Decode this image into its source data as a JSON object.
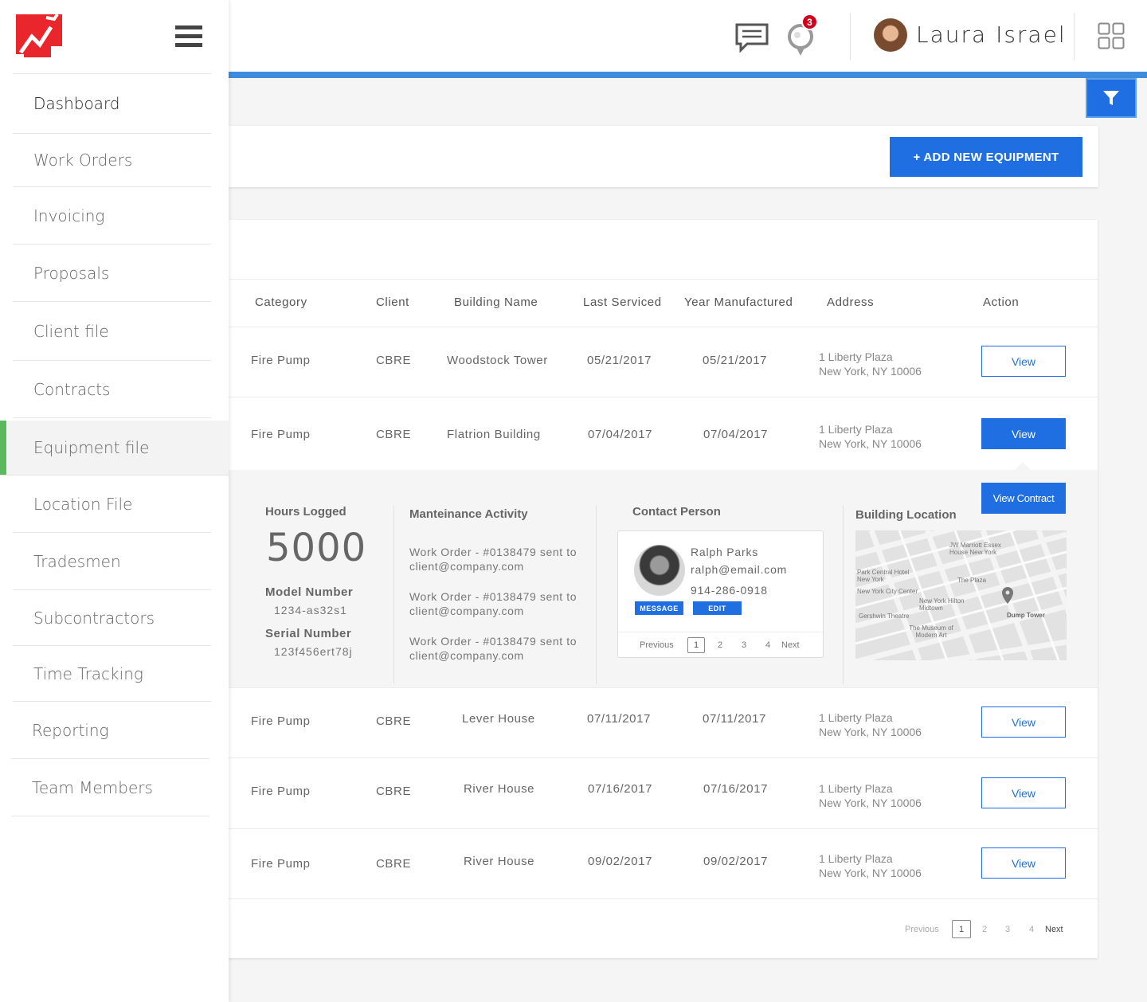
{
  "header": {
    "user_name": "Laura Israel",
    "notification_count": "3",
    "icons": [
      "chat-icon",
      "bell-icon",
      "apps-grid-icon",
      "filter-icon",
      "hamburger-menu-icon"
    ]
  },
  "sidebar": {
    "items": [
      {
        "label": "Dashboard"
      },
      {
        "label": "Work Orders"
      },
      {
        "label": "Invoicing"
      },
      {
        "label": "Proposals"
      },
      {
        "label": "Client file"
      },
      {
        "label": "Contracts"
      },
      {
        "label": "Equipment file"
      },
      {
        "label": "Location File"
      },
      {
        "label": "Tradesmen"
      },
      {
        "label": "Subcontractors"
      },
      {
        "label": "Time Tracking"
      },
      {
        "label": "Reporting"
      },
      {
        "label": "Team Members"
      }
    ],
    "active": "Equipment file",
    "active_color": "#5cb85c"
  },
  "toolbar": {
    "add_label": "+ ADD NEW EQUIPMENT"
  },
  "table": {
    "headers": [
      "Category",
      "Client",
      "Building Name",
      "Last Serviced",
      "Year Manufactured",
      "Address",
      "Action"
    ],
    "rows": [
      {
        "category": "Fire Pump",
        "client": "CBRE",
        "building": "Woodstock Tower",
        "last_serviced": "05/21/2017",
        "year": "05/21/2017",
        "addr1": "1 Liberty Plaza",
        "addr2": "New York, NY 10006",
        "action": "View"
      },
      {
        "category": "Fire Pump",
        "client": "CBRE",
        "building": "Flatrion Building",
        "last_serviced": "07/04/2017",
        "year": "07/04/2017",
        "addr1": "1 Liberty Plaza",
        "addr2": "New York, NY 10006",
        "action": "View"
      },
      {
        "category": "Fire Pump",
        "client": "CBRE",
        "building": "Lever House",
        "last_serviced": "07/11/2017",
        "year": "07/11/2017",
        "addr1": "1 Liberty Plaza",
        "addr2": "New York, NY 10006",
        "action": "View"
      },
      {
        "category": "Fire Pump",
        "client": "CBRE",
        "building": "River House",
        "last_serviced": "07/16/2017",
        "year": "07/16/2017",
        "addr1": "1 Liberty Plaza",
        "addr2": "New York, NY 10006",
        "action": "View"
      },
      {
        "category": "Fire Pump",
        "client": "CBRE",
        "building": "River House",
        "last_serviced": "09/02/2017",
        "year": "09/02/2017",
        "addr1": "1 Liberty Plaza",
        "addr2": "New York, NY 10006",
        "action": "View"
      }
    ],
    "pagination": {
      "prev": "Previous",
      "pages": [
        "1",
        "2",
        "3",
        "4"
      ],
      "next": "Next"
    }
  },
  "detail": {
    "hours_title": "Hours Logged",
    "hours_value": "5000",
    "model_label": "Model Number",
    "model_value": "1234-as32s1",
    "serial_label": "Serial Number",
    "serial_value": "123f456ert78j",
    "activity_title": "Manteinance Activity",
    "activities": [
      {
        "line1": "Work Order - #0138479 sent to",
        "line2": "client@company.com"
      },
      {
        "line1": "Work Order - #0138479 sent to",
        "line2": "client@company.com"
      },
      {
        "line1": "Work Order - #0138479 sent to",
        "line2": "client@company.com"
      }
    ],
    "contact_title": "Contact Person",
    "contact": {
      "name": "Ralph Parks",
      "email": "ralph@email.com",
      "phone": "914-286-0918",
      "message_label": "MESSAGE",
      "edit_label": "EDIT"
    },
    "contact_pagination": {
      "prev": "Previous",
      "pages": [
        "1",
        "2",
        "3",
        "4"
      ],
      "next": "Next"
    },
    "location_title": "Building Location",
    "view_contract_label": "View Contract",
    "map_labels": {
      "jw": "JW Marriott Essex House New York",
      "park": "Park Central Hotel New York",
      "nycc": "New York City Center",
      "plaza": "The Plaza",
      "gershwin": "Gershwin Theatre",
      "hilton": "New York Hilton Midtown",
      "moma": "The Museum of Modern Art",
      "dump": "Dump Tower"
    }
  },
  "colors": {
    "primary": "#1f6fe3",
    "accent_strip": "#3e8bde",
    "logo_red": "#e8262b",
    "badge_red": "#d0021b"
  }
}
